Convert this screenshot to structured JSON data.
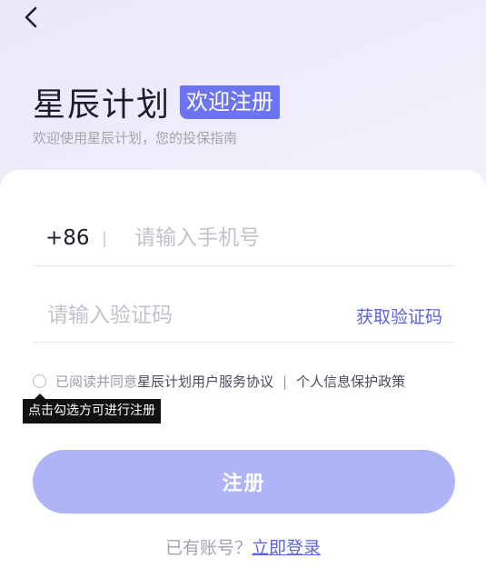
{
  "header": {
    "back_icon": "chevron-left-icon"
  },
  "brand": {
    "title": "星辰计划",
    "badge": "欢迎注册",
    "subtitle": "欢迎使用星辰计划，您的投保指南",
    "accent_color": "#6d74f2"
  },
  "form": {
    "country_code": "+86",
    "divider": "|",
    "phone_placeholder": "请输入手机号",
    "phone_value": "",
    "code_placeholder": "请输入验证码",
    "code_value": "",
    "get_code_label": "获取验证码"
  },
  "agreement": {
    "checked": false,
    "prefix": "已阅读并同意",
    "service_link": "星辰计划用户服务协议",
    "separator": "|",
    "privacy_link": "个人信息保护政策",
    "tooltip": "点击勾选方可进行注册"
  },
  "submit": {
    "label": "注册",
    "disabled_color": "#aeb4f7"
  },
  "footer": {
    "prompt": "已有账号？",
    "login_link": "立即登录"
  }
}
